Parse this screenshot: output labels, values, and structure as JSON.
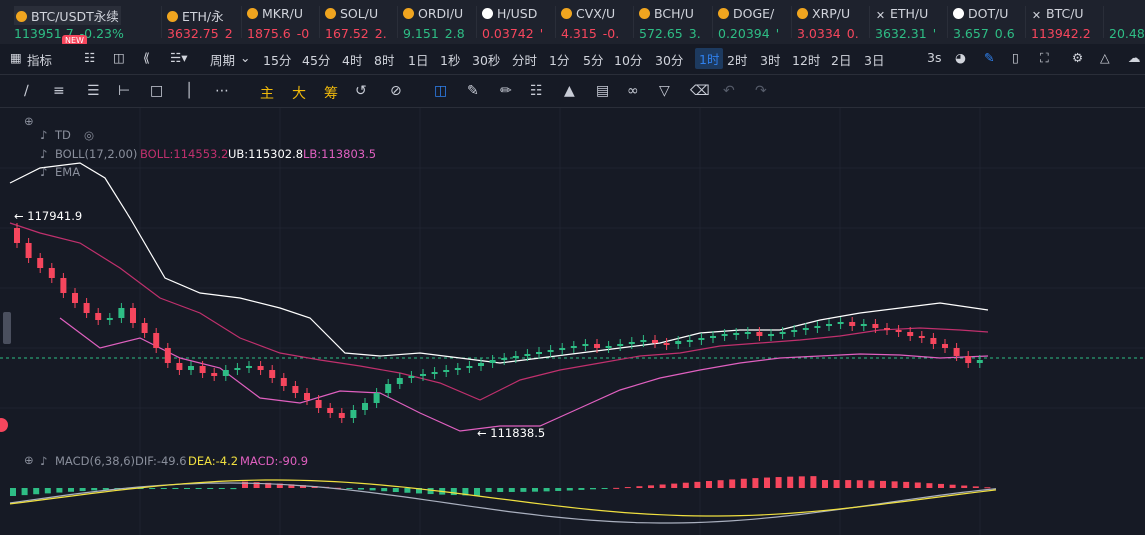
{
  "tickers": [
    {
      "name": "BTC/USDT永续",
      "price": "113951.7",
      "change": "-0.23%",
      "price_dir": "up",
      "change_dir": "up",
      "icon": "btc-dot"
    },
    {
      "name": "ETH/永",
      "price": "3632.75",
      "change": "2",
      "price_dir": "dn",
      "change_dir": "dn",
      "icon": "dot"
    },
    {
      "name": "MKR/U",
      "price": "1875.6",
      "change": "-0",
      "price_dir": "dn",
      "change_dir": "dn",
      "icon": "dot"
    },
    {
      "name": "SOL/U",
      "price": "167.52",
      "change": "2.",
      "price_dir": "dn",
      "change_dir": "dn",
      "icon": "dot"
    },
    {
      "name": "ORDI/U",
      "price": "9.151",
      "change": "2.8",
      "price_dir": "up",
      "change_dir": "up",
      "icon": "dot"
    },
    {
      "name": "H/USD",
      "price": "0.03742",
      "change": "'",
      "price_dir": "dn",
      "change_dir": "dn",
      "icon": "dot-white"
    },
    {
      "name": "CVX/U",
      "price": "4.315",
      "change": "-0.",
      "price_dir": "dn",
      "change_dir": "dn",
      "icon": "dot"
    },
    {
      "name": "BCH/U",
      "price": "572.65",
      "change": "3.",
      "price_dir": "up",
      "change_dir": "up",
      "icon": "dot"
    },
    {
      "name": "DOGE/",
      "price": "0.20394",
      "change": "'",
      "price_dir": "up",
      "change_dir": "up",
      "icon": "dot"
    },
    {
      "name": "XRP/U",
      "price": "3.0334",
      "change": "0.",
      "price_dir": "dn",
      "change_dir": "dn",
      "icon": "dot"
    },
    {
      "name": "ETH/U",
      "price": "3632.31",
      "change": "'",
      "price_dir": "up",
      "change_dir": "up",
      "icon": "x"
    },
    {
      "name": "DOT/U",
      "price": "3.657",
      "change": "0.6",
      "price_dir": "up",
      "change_dir": "up",
      "icon": "dot-white"
    },
    {
      "name": "BTC/U",
      "price": "113942.2",
      "change": "",
      "price_dir": "dn",
      "change_dir": "dn",
      "icon": "x"
    },
    {
      "name": "",
      "price": "20.48",
      "change": "",
      "price_dir": "up",
      "change_dir": "up",
      "icon": "none"
    }
  ],
  "new_badge": "NEW",
  "toolbar": {
    "indicator_label": "指标",
    "period_label": "周期",
    "intervals": [
      "15分",
      "45分",
      "4时",
      "8时",
      "1日",
      "1秒",
      "30秒",
      "分时",
      "1分",
      "5分",
      "10分",
      "30分",
      "1时",
      "2时",
      "3时",
      "12时",
      "2日",
      "3日"
    ],
    "active_interval": "1时",
    "refresh": "3s"
  },
  "drawing_tools": {
    "main": "主",
    "big": "大",
    "chip": "筹"
  },
  "indicators": {
    "td": "TD",
    "boll_name": "BOLL(17,2.00)",
    "boll_mid": "BOLL:114553.2",
    "boll_ub": "UB:115302.8",
    "boll_lb": "LB:113803.5",
    "ema": "EMA",
    "macd_name": "MACD(6,38,6)",
    "dif": "DIF:-49.6",
    "dea": "DEA:-4.2",
    "macd": "MACD:-90.9"
  },
  "annotations": {
    "high": "117941.9",
    "low": "111838.5"
  },
  "colors": {
    "up": "#2ebd85",
    "down": "#f6465d",
    "boll_upper": "#ffffff",
    "boll_mid": "#c0306d",
    "boll_lower": "#e060c0",
    "dea": "#f0e040",
    "active": "#2f80ed"
  }
}
